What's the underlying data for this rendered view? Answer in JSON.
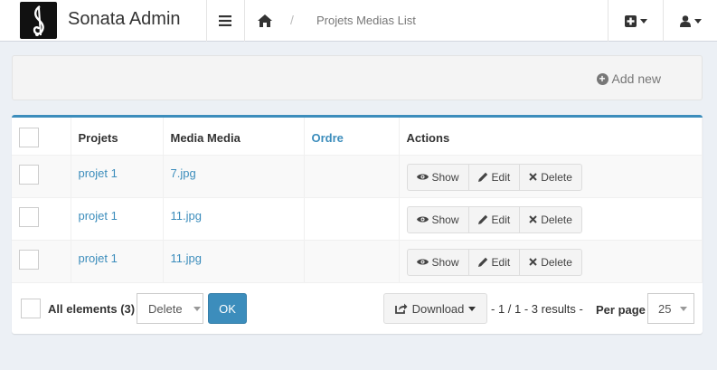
{
  "header": {
    "brand": "Sonata Admin",
    "breadcrumb_current": "Projets Medias List",
    "breadcrumb_separator": "/"
  },
  "actions": {
    "add_new": "Add new"
  },
  "table": {
    "columns": [
      "Projets",
      "Media Media",
      "Ordre",
      "Actions"
    ],
    "rows": [
      {
        "projet": "projet 1",
        "media": "7.jpg",
        "ordre": ""
      },
      {
        "projet": "projet 1",
        "media": "11.jpg",
        "ordre": ""
      },
      {
        "projet": "projet 1",
        "media": "11.jpg",
        "ordre": ""
      }
    ],
    "row_actions": {
      "show": "Show",
      "edit": "Edit",
      "delete": "Delete"
    }
  },
  "footer": {
    "all_elements": "All elements (3)",
    "batch_action": "Delete",
    "ok": "OK",
    "download": "Download",
    "pager": "- 1 / 1 - 3 results -",
    "per_page_label": "Per page",
    "per_page_value": "25"
  },
  "colors": {
    "accent": "#3c8dbc",
    "background": "#ecf0f5"
  }
}
